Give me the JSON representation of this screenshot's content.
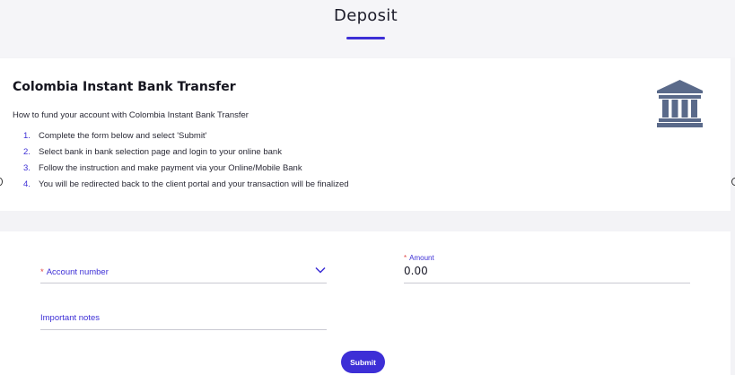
{
  "page": {
    "title": "Deposit"
  },
  "colors": {
    "accent": "#3d2fd6",
    "required": "#e04646",
    "icon": "#5a6a8a"
  },
  "info": {
    "title": "Colombia Instant Bank Transfer",
    "intro": "How to fund your account with Colombia Instant Bank Transfer",
    "icon": "bank-icon",
    "steps": [
      {
        "num": "1.",
        "text": "Complete the form below and select 'Submit'"
      },
      {
        "num": "2.",
        "text": "Select bank in bank selection page and login to your online bank"
      },
      {
        "num": "3.",
        "text": "Follow the instruction and make payment via your Online/Mobile Bank"
      },
      {
        "num": "4.",
        "text": "You will be redirected back to the client portal and your transaction will be finalized"
      }
    ]
  },
  "form": {
    "account": {
      "required_mark": "*",
      "label": "Account number",
      "icon": "chevron-down-icon"
    },
    "amount": {
      "required_mark": "*",
      "label": "Amount",
      "value": "0.00"
    },
    "notes": {
      "label": "Important notes"
    },
    "submit_label": "Submit"
  }
}
